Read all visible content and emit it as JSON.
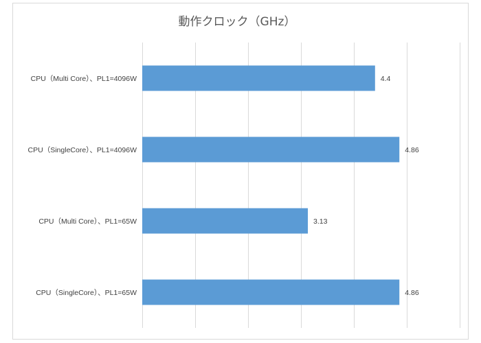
{
  "chart_data": {
    "type": "bar",
    "orientation": "horizontal",
    "title": "動作クロック（GHz）",
    "xlabel": "",
    "ylabel": "",
    "categories": [
      "CPU（Multi Core）、PL1=4096W",
      "CPU（SingleCore）、PL1=4096W",
      "CPU（Multi Core）、PL1=65W",
      "CPU（SingleCore）、PL1=65W"
    ],
    "values": [
      4.4,
      4.86,
      3.13,
      4.86
    ],
    "value_labels": [
      "4.4",
      "4.86",
      "3.13",
      "4.86"
    ],
    "xlim": [
      0,
      6
    ],
    "grid": true,
    "grid_step": 1,
    "show_tick_labels": false,
    "legend": "none",
    "colors": {
      "bar": "#5b9bd5",
      "grid": "#d9d9d9",
      "title": "#595959",
      "text": "#404040",
      "border": "#d9d9d9"
    }
  }
}
